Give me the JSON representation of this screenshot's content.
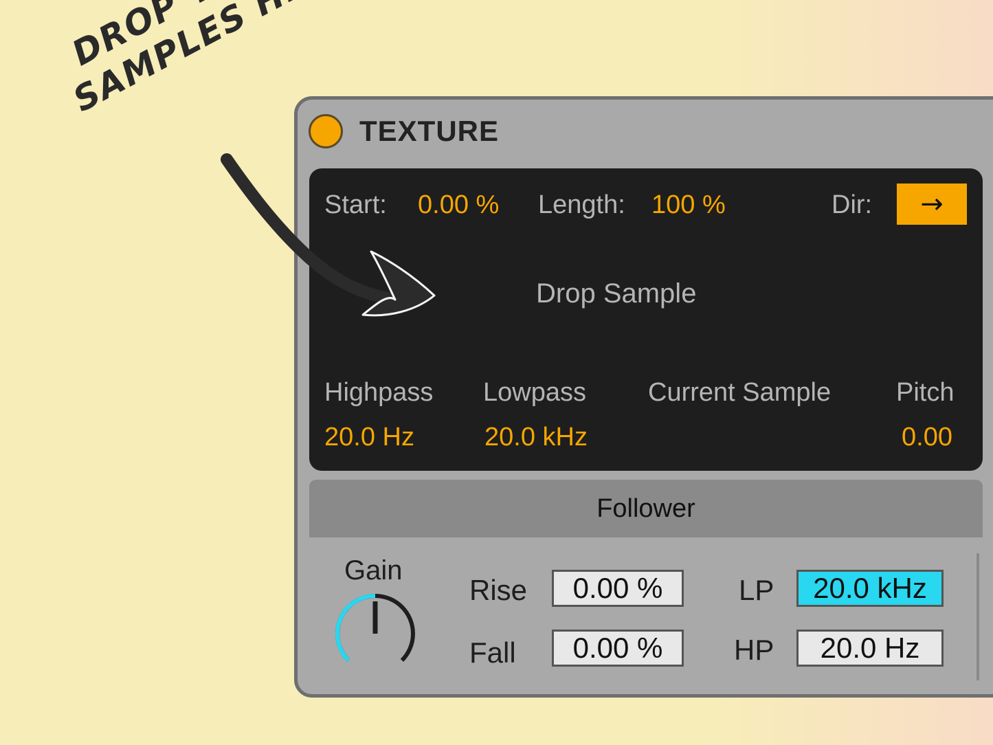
{
  "annotation": {
    "line1": "DROP YOUR",
    "line2": "SAMPLES HERE"
  },
  "device": {
    "title": "TEXTURE",
    "screen": {
      "start_label": "Start:",
      "start_value": "0.00 %",
      "length_label": "Length:",
      "length_value": "100 %",
      "dir_label": "Dir:",
      "dir_button": "→",
      "drop_text": "Drop Sample",
      "highpass_label": "Highpass",
      "highpass_value": "20.0 Hz",
      "lowpass_label": "Lowpass",
      "lowpass_value": "20.0 kHz",
      "current_sample_label": "Current Sample",
      "pitch_label": "Pitch",
      "pitch_value": "0.00"
    },
    "follower": {
      "section_label": "Follower",
      "gain_label": "Gain",
      "gain_level": 0.5,
      "rise_label": "Rise",
      "rise_value": "0.00 %",
      "fall_label": "Fall",
      "fall_value": "0.00 %",
      "lp_label": "LP",
      "lp_value": "20.0 kHz",
      "hp_label": "HP",
      "hp_value": "20.0 Hz"
    }
  },
  "colors": {
    "accent": "#f7a600",
    "active_field": "#29d7f0",
    "screen_bg": "#1e1e1e",
    "device_bg": "#a9a9a9"
  }
}
